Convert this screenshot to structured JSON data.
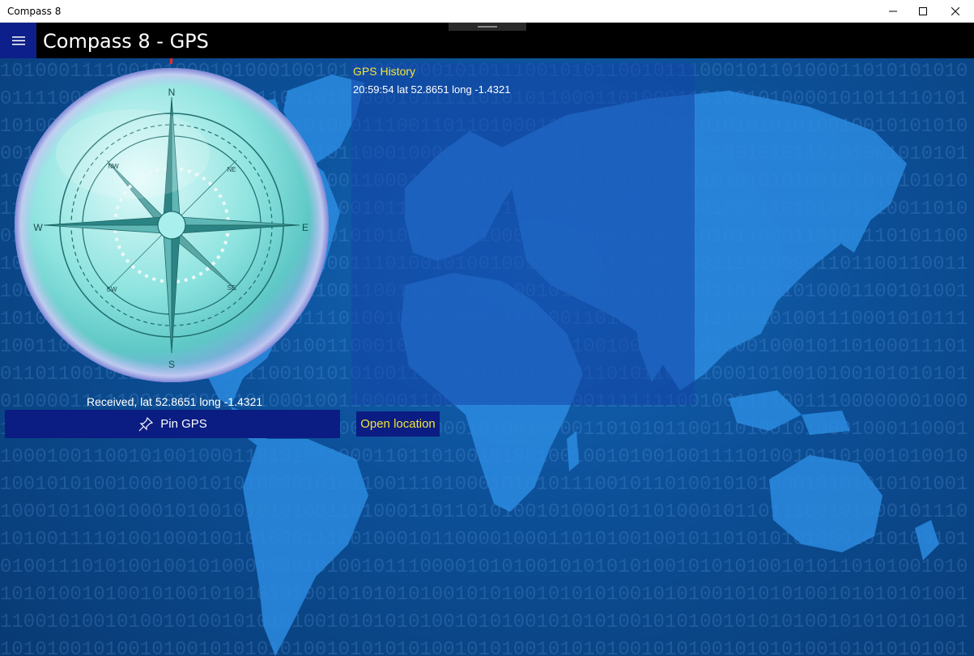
{
  "window": {
    "title": "Compass 8"
  },
  "header": {
    "title": "Compass 8 - GPS"
  },
  "compass": {
    "directions": {
      "north": "N",
      "south": "S",
      "east": "E",
      "west": "W",
      "ne": "NE",
      "nw": "NW",
      "se": "SE",
      "sw": "SW"
    }
  },
  "status": {
    "received": "Received, lat 52.8651 long -1.4321"
  },
  "buttons": {
    "pin_gps": "Pin GPS",
    "open_location": "Open location"
  },
  "history": {
    "title": "GPS History",
    "entries": [
      "20:59:54 lat 52.8651 long -1.4321"
    ]
  },
  "colors": {
    "accent": "#0b1c82",
    "history_title": "#f2e53a",
    "background": "#0a3d78"
  },
  "icons": {
    "menu": "hamburger-icon",
    "pin": "pin-icon",
    "minimize": "minimize-icon",
    "maximize": "maximize-icon",
    "close": "close-icon"
  }
}
